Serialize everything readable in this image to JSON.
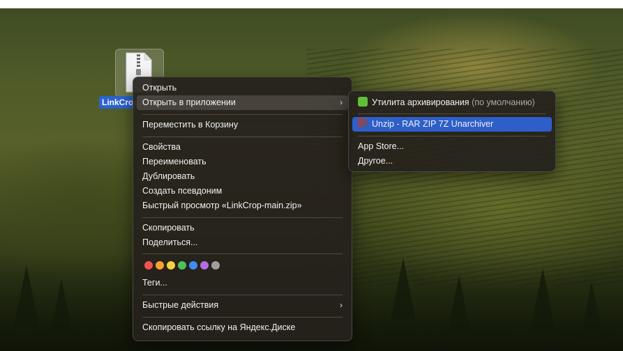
{
  "desktop": {
    "file_name": "LinkCrop-main.zip",
    "file_label_visible": "LinkCrop"
  },
  "context_menu": {
    "open": "Открыть",
    "open_with": "Открыть в приложении",
    "move_to_trash": "Переместить в Корзину",
    "get_info": "Свойства",
    "rename": "Переименовать",
    "duplicate": "Дублировать",
    "make_alias": "Создать псевдоним",
    "quick_look": "Быстрый просмотр «LinkCrop-main.zip»",
    "copy": "Скопировать",
    "share": "Поделиться...",
    "tags": "Теги...",
    "quick_actions": "Быстрые действия",
    "copy_yandex_link": "Скопировать ссылку на Яндекс.Диске",
    "tag_colors": [
      "#ef5350",
      "#f6a02e",
      "#f7d23e",
      "#4cc35a",
      "#3f8cf2",
      "#b66be0",
      "#9e9e9e"
    ]
  },
  "submenu": {
    "archive_utility": "Утилита архивирования",
    "archive_utility_default": "(по умолчанию)",
    "unzip_app": "Unzip - RAR ZIP 7Z Unarchiver",
    "app_store": "App Store...",
    "other": "Другое..."
  },
  "colors": {
    "selection_blue": "#2e5fc9",
    "file_label_blue": "#2a63d2",
    "archive_icon_green": "#5fbf3a"
  }
}
